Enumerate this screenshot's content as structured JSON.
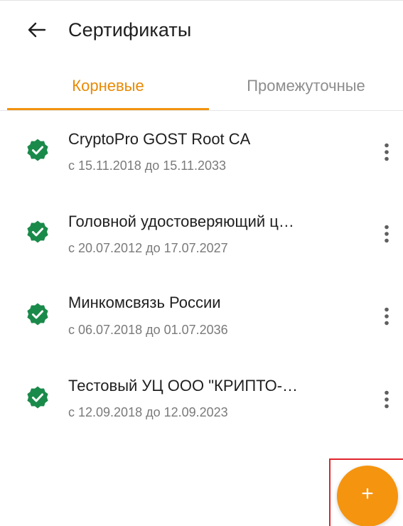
{
  "app_bar": {
    "title": "Сертификаты",
    "back_icon": "arrow-left-icon"
  },
  "tabs": [
    {
      "label": "Корневые",
      "active": true
    },
    {
      "label": "Промежуточные",
      "active": false
    }
  ],
  "certificates": [
    {
      "name": "CryptoPro GOST Root CA",
      "dates": "с 15.11.2018 до 15.11.2033"
    },
    {
      "name": "Головной удостоверяющий ц…",
      "dates": "с 20.07.2012 до 17.07.2027"
    },
    {
      "name": "Минкомсвязь России",
      "dates": "с 06.07.2018 до 01.07.2036"
    },
    {
      "name": "Тестовый УЦ ООО \"КРИПТО-…",
      "dates": "с 12.09.2018 до 12.09.2023"
    }
  ],
  "fab": {
    "label": "+"
  },
  "colors": {
    "accent": "#f5940f",
    "active_tab_text": "#e88a05",
    "verified_green": "#1a8a4a",
    "highlight_frame": "#e0242b"
  },
  "icons": {
    "verified": "verified-badge-icon",
    "more": "more-vert-icon",
    "add": "plus-icon"
  }
}
